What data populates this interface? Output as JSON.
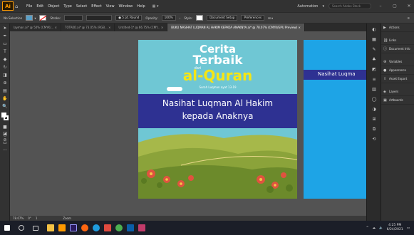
{
  "app": {
    "logo": "Ai",
    "menus": [
      "File",
      "Edit",
      "Object",
      "Type",
      "Select",
      "Effect",
      "View",
      "Window",
      "Help"
    ],
    "workspace": "Automation",
    "search_placeholder": "Search Adobe Stock"
  },
  "control_bar": {
    "selection": "No Selection",
    "stroke_label": "Stroke:",
    "stroke_value": "",
    "brush": "5 pt. Round",
    "opacity_label": "Opacity:",
    "opacity_value": "100%",
    "style_label": "Style:",
    "doc_setup": "Document Setup",
    "preferences": "Preferences"
  },
  "tabs": [
    {
      "label": "layman.ai* @ 50% (CMYK/..."
    },
    {
      "label": "TOTAKO.ai* @ 73.05% (RGB..."
    },
    {
      "label": "Untitled-1* @ 66.75% (CMY..."
    },
    {
      "label": "BUKU NASIHAT LUQMAN AL HAKIM KEPADA ANAKNYA.ai* @ 78.07% (CMYK/GPU Preview)"
    }
  ],
  "cover": {
    "line1": "Cerita",
    "line2": "Terbaik",
    "small": "dari",
    "line3": "al-Quran",
    "subtitle": "Surah Luqman ayat 13-19",
    "band1": "Nasihat Luqman Al Hakim",
    "band2": "kepada Anaknya"
  },
  "cover2": {
    "band": "Nasihat Luqma"
  },
  "panels": [
    "Actions",
    "Links",
    "Document Info",
    "Variables",
    "Appearance",
    "Asset Export",
    "Layers",
    "Artboards"
  ],
  "status": {
    "zoom": "78.07%",
    "angle": "0°",
    "page": "1",
    "tool": "Zoom"
  },
  "taskbar": {
    "time": "4:25 PM",
    "date": "6/24/2021"
  },
  "colors": {
    "accent": "#ff9a00",
    "sky": "#6fc7d4",
    "band": "#2e3192",
    "title_yellow": "#f5e614"
  }
}
